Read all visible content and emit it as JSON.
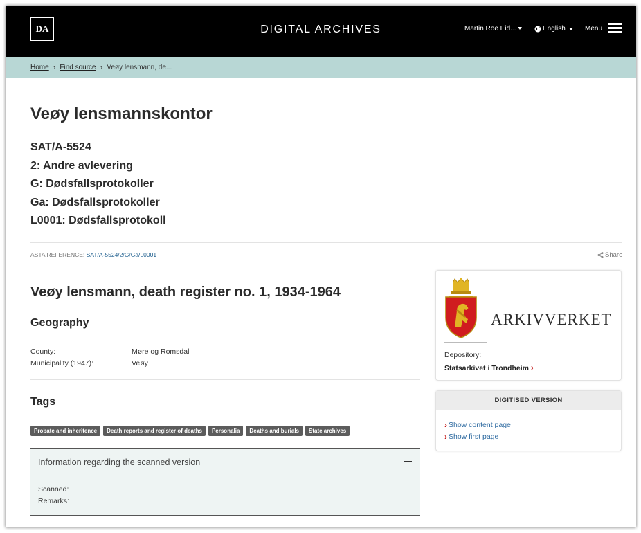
{
  "header": {
    "logo_text": "DA",
    "site_title": "DIGITAL ARCHIVES",
    "user_name": "Martin Roe Eid...",
    "language": "English",
    "menu_label": "Menu"
  },
  "breadcrumb": {
    "items": [
      "Home",
      "Find source"
    ],
    "current": "Veøy lensmann, de..."
  },
  "archive": {
    "title": "Veøy lensmannskontor",
    "hierarchy": [
      "SAT/A-5524",
      "2: Andre avlevering",
      "G: Dødsfallsprotokoller",
      "Ga: Dødsfallsprotokoller",
      "L0001: Dødsfallsprotokoll"
    ]
  },
  "reference": {
    "label": "ASTA REFERENCE:",
    "value": "SAT/A-5524/2/G/Ga/L0001",
    "share_label": "Share"
  },
  "record": {
    "title": "Veøy lensmann, death register no. 1, 1934-1964"
  },
  "geography": {
    "heading": "Geography",
    "rows": [
      {
        "label": "County:",
        "value": "Møre og Romsdal"
      },
      {
        "label": "Municipality (1947):",
        "value": "Veøy"
      }
    ]
  },
  "tags": {
    "heading": "Tags",
    "items": [
      "Probate and inheritence",
      "Death reports and register of deaths",
      "Personalia",
      "Deaths and burials",
      "State archives"
    ]
  },
  "scanned": {
    "title": "Information regarding the scanned version",
    "scanned_label": "Scanned:",
    "remarks_label": "Remarks:"
  },
  "depository": {
    "org_name": "ARKIVVERKET",
    "label": "Depository:",
    "value": "Statsarkivet i Trondheim"
  },
  "digitised": {
    "heading": "DIGITISED VERSION",
    "links": [
      "Show content page",
      "Show first page"
    ]
  },
  "icons": {
    "globe": "globe-icon",
    "share": "share-icon",
    "coat_of_arms": "coat-of-arms-icon",
    "hamburger": "hamburger-icon"
  },
  "colors": {
    "header_bg": "#000000",
    "breadcrumb_bg": "#b8d7d5",
    "link_blue": "#2d6aa0",
    "accent_red": "#c21a1a",
    "tag_bg": "#5c5c5c",
    "panel_bg": "#eef4f3"
  }
}
